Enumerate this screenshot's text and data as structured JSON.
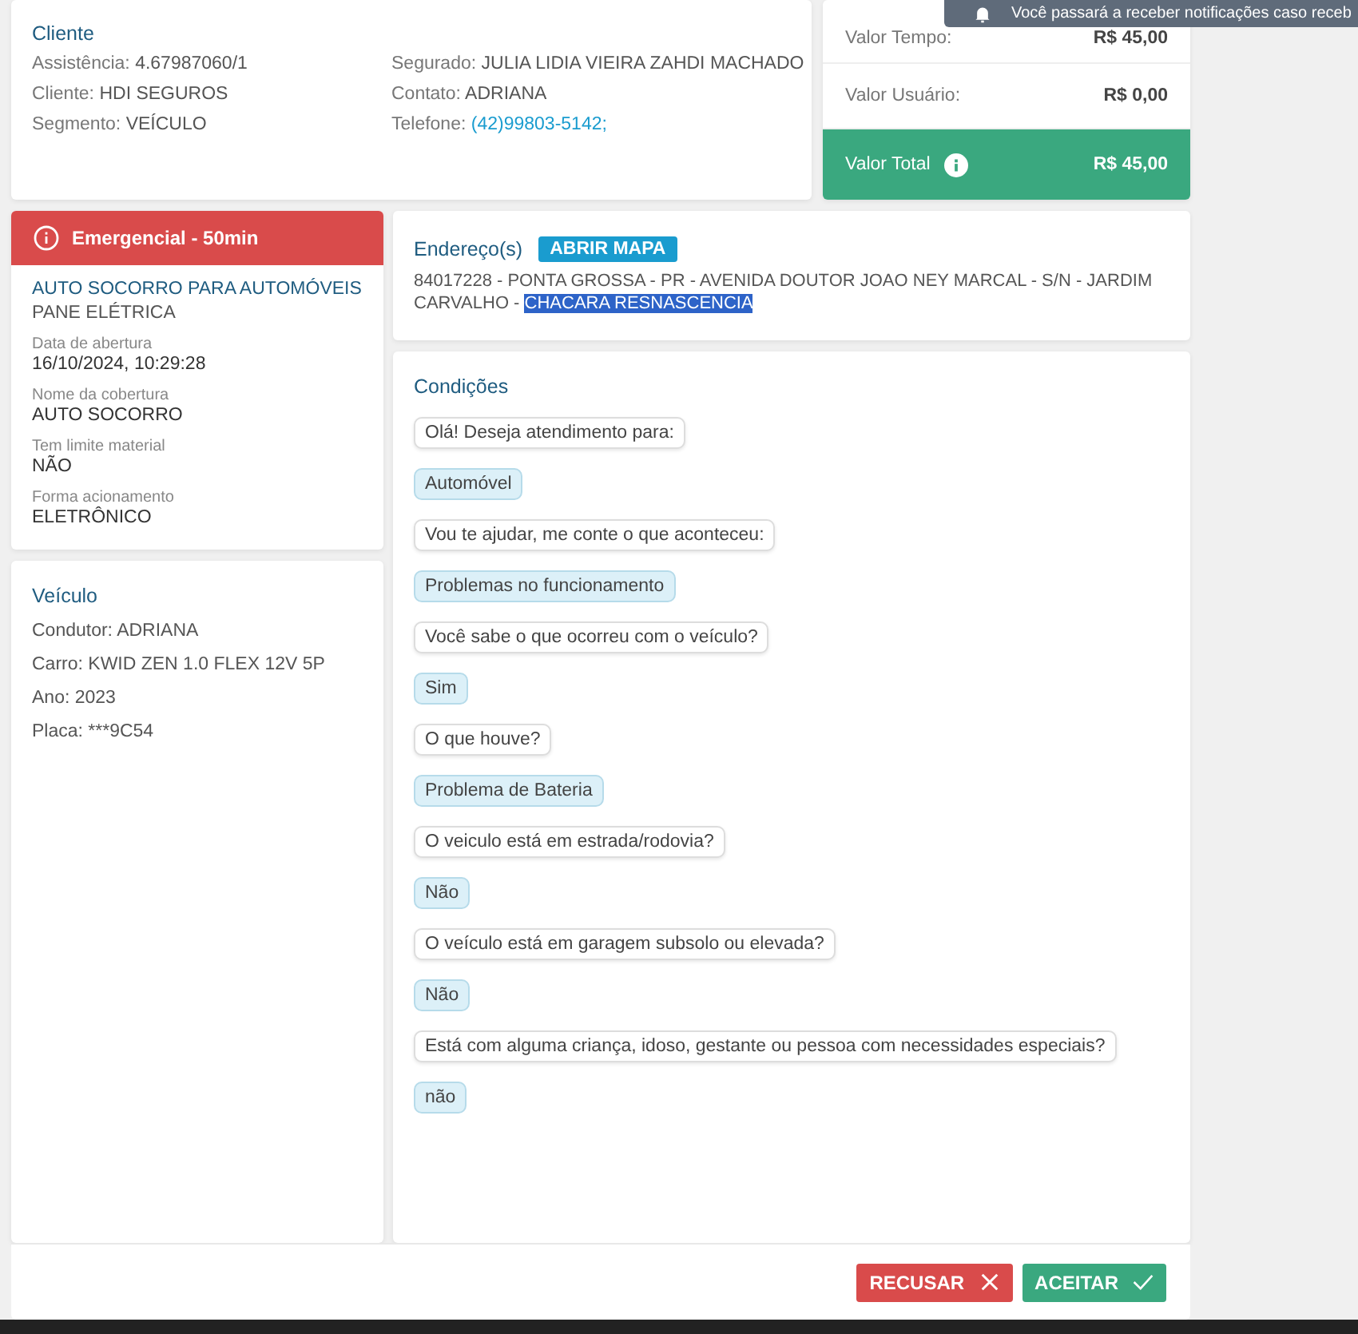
{
  "toast": {
    "text": "Você passará a receber notificações caso receb"
  },
  "cliente": {
    "title": "Cliente",
    "left": [
      {
        "label": "Assistência:",
        "value": "4.67987060/1",
        "kind": "text"
      },
      {
        "label": "Cliente:",
        "value": "HDI SEGUROS",
        "kind": "text"
      },
      {
        "label": "Segmento:",
        "value": "VEÍCULO",
        "kind": "text"
      }
    ],
    "right": [
      {
        "label": "Segurado:",
        "value": "JULIA LIDIA VIEIRA ZAHDI MACHADO",
        "kind": "text"
      },
      {
        "label": "Contato:",
        "value": "ADRIANA",
        "kind": "text"
      },
      {
        "label": "Telefone:",
        "value": "(42)99803-5142;",
        "kind": "link"
      }
    ]
  },
  "valores": [
    {
      "label": "Valor Tempo:",
      "value": "R$ 45,00",
      "total": false
    },
    {
      "label": "Valor Usuário:",
      "value": "R$ 0,00",
      "total": false
    },
    {
      "label": "Valor Total",
      "value": "R$ 45,00",
      "total": true
    }
  ],
  "servico": {
    "badge": "Emergencial - 50min",
    "title": "AUTO SOCORRO PARA AUTOMÓVEIS",
    "subtitle": "PANE ELÉTRICA",
    "fields": [
      {
        "label": "Data de abertura",
        "value": "16/10/2024, 10:29:28"
      },
      {
        "label": "Nome da cobertura",
        "value": "AUTO SOCORRO"
      },
      {
        "label": "Tem limite material",
        "value": "NÃO"
      },
      {
        "label": "Forma acionamento",
        "value": "ELETRÔNICO"
      }
    ]
  },
  "veiculo": {
    "title": "Veículo",
    "rows": [
      "Condutor: ADRIANA",
      "Carro: KWID ZEN 1.0 FLEX 12V 5P",
      "Ano: 2023",
      "Placa: ***9C54"
    ]
  },
  "endereco": {
    "title": "Endereço(s)",
    "map_button": "ABRIR MAPA",
    "address": "84017228 - PONTA GROSSA - PR - AVENIDA DOUTOR JOAO NEY MARCAL - S/N - JARDIM CARVALHO - ",
    "selected_text": "CHACARA RESNASCENCIA"
  },
  "condicoes": {
    "title": "Condições",
    "messages": [
      {
        "kind": "question",
        "text": "Olá! Deseja atendimento para:"
      },
      {
        "kind": "answer",
        "text": "Automóvel"
      },
      {
        "kind": "question",
        "text": "Vou te ajudar, me conte o que aconteceu:"
      },
      {
        "kind": "answer",
        "text": "Problemas no funcionamento"
      },
      {
        "kind": "question",
        "text": "Você sabe o que ocorreu com o veículo?"
      },
      {
        "kind": "answer",
        "text": "Sim"
      },
      {
        "kind": "question",
        "text": "O que houve?"
      },
      {
        "kind": "answer",
        "text": "Problema de Bateria"
      },
      {
        "kind": "question",
        "text": "O veiculo está em estrada/rodovia?"
      },
      {
        "kind": "answer",
        "text": "Não"
      },
      {
        "kind": "question",
        "text": "O veículo está em garagem subsolo ou elevada?"
      },
      {
        "kind": "answer",
        "text": "Não"
      },
      {
        "kind": "question",
        "text": "Está com alguma criança, idoso, gestante ou pessoa com necessidades especiais?"
      },
      {
        "kind": "answer",
        "text": "não"
      }
    ]
  },
  "buttons": [
    {
      "kind": "reject",
      "label": "RECUSAR"
    },
    {
      "kind": "accept",
      "label": "ACEITAR"
    }
  ]
}
